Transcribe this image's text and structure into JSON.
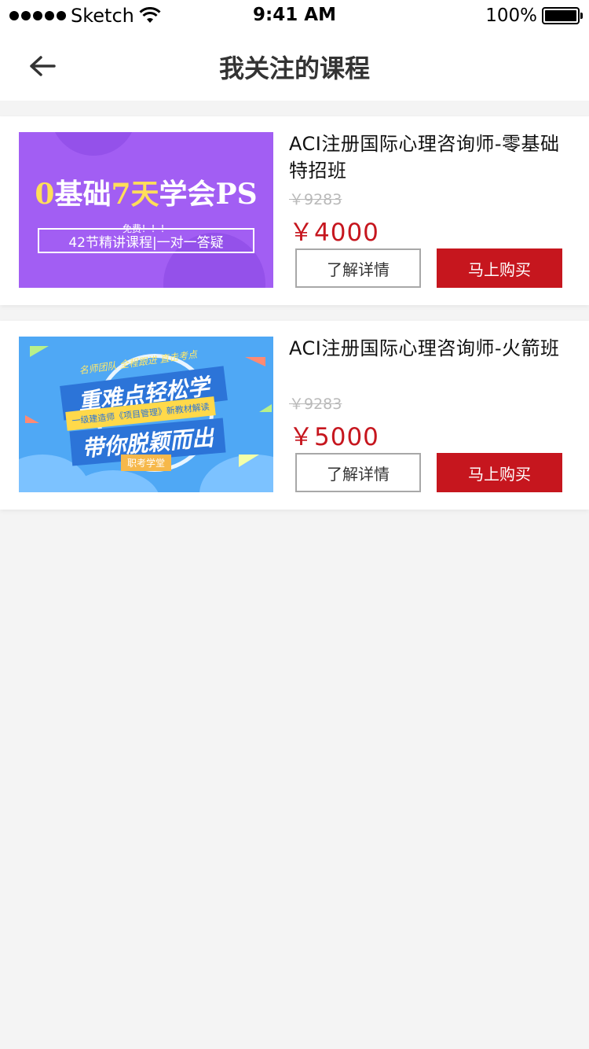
{
  "status_bar": {
    "carrier": "Sketch",
    "time": "9:41 AM",
    "battery": "100%"
  },
  "nav": {
    "title": "我关注的课程",
    "back_icon": "arrow-left-icon"
  },
  "courses": [
    {
      "title": "ACI注册国际心理咨询师-零基础特招班",
      "original_price": "￥9283",
      "price": "￥4000",
      "detail_label": "了解详情",
      "buy_label": "马上购买",
      "thumb": {
        "headline_part1": "0",
        "headline_part2": "基础",
        "headline_part3": "7天",
        "headline_part4": "学会PS",
        "free_text": "免费！！！",
        "box_text": "42节精讲课程|一对一答疑"
      }
    },
    {
      "title": "ACI注册国际心理咨询师-火箭班",
      "original_price": "￥9283",
      "price": "￥5000",
      "detail_label": "了解详情",
      "buy_label": "马上购买",
      "thumb": {
        "top_tags": "名师团队  全程跟进  直击考点",
        "line1": "重难点轻松学",
        "subline": "一级建造师《项目管理》新教材解读",
        "line2": "带你脱颖而出",
        "badge": "职考学堂"
      }
    }
  ],
  "colors": {
    "accent_red": "#c6161e",
    "background": "#f4f4f4",
    "strike_gray": "#b9b9b9"
  }
}
